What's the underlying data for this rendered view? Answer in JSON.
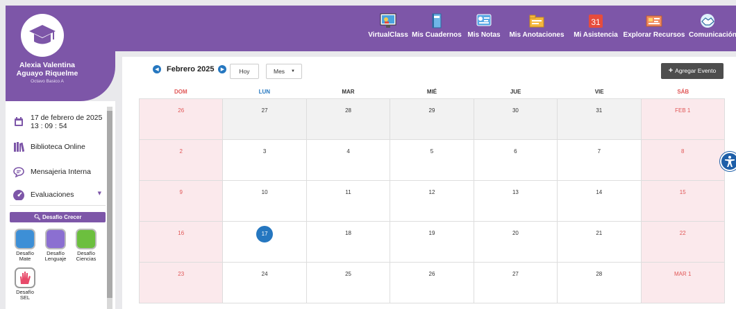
{
  "nav": [
    {
      "label": "VirtualClass",
      "icon": "virtualclass-icon"
    },
    {
      "label": "Mis Cuadernos",
      "icon": "notebook-icon"
    },
    {
      "label": "Mis Notas",
      "icon": "grades-icon"
    },
    {
      "label": "Mis Anotaciones",
      "icon": "folder-icon"
    },
    {
      "label": "Mi Asistencia",
      "icon": "calendar-31-icon"
    },
    {
      "label": "Explorar Recursos",
      "icon": "resources-icon"
    },
    {
      "label": "Comunicación",
      "icon": "handshake-icon"
    }
  ],
  "profile": {
    "name_line1": "Alexia Valentina",
    "name_line2": "Aguayo Riquelme",
    "grade": "Octavo Basico A",
    "avatar_icon": "graduation-cap-icon"
  },
  "sidebar": {
    "datetime_date": "17 de febrero de 2025",
    "datetime_time": "13 : 09 : 54",
    "items": [
      {
        "label": "Biblioteca Online",
        "icon": "library-icon"
      },
      {
        "label": "Mensajeria Interna",
        "icon": "chat-bubble-icon"
      },
      {
        "label": "Evaluaciones",
        "icon": "gauge-icon"
      }
    ],
    "desafio_button": "Desafío Crecer",
    "games": [
      {
        "line1": "Desafío",
        "line2": "Mate",
        "color": "#3d8fd6"
      },
      {
        "line1": "Desafío",
        "line2": "Lenguaje",
        "color": "#8b6fd1"
      },
      {
        "line1": "Desafío",
        "line2": "Ciencias",
        "color": "#6cbf3e"
      },
      {
        "line1": "Desafío",
        "line2": "SEL",
        "color": "#e84a6a"
      }
    ]
  },
  "calendar": {
    "month_label": "Febrero 2025",
    "today_button": "Hoy",
    "view_select": "Mes",
    "add_event_button": "Agregar Evento",
    "weekdays": [
      "DOM",
      "LUN",
      "MAR",
      "MIÉ",
      "JUE",
      "VIE",
      "SÁB"
    ],
    "weeks": [
      [
        "26",
        "27",
        "28",
        "29",
        "30",
        "31",
        "FEB 1"
      ],
      [
        "2",
        "3",
        "4",
        "5",
        "6",
        "7",
        "8"
      ],
      [
        "9",
        "10",
        "11",
        "12",
        "13",
        "14",
        "15"
      ],
      [
        "16",
        "17",
        "18",
        "19",
        "20",
        "21",
        "22"
      ],
      [
        "23",
        "24",
        "25",
        "26",
        "27",
        "28",
        "MAR 1"
      ]
    ],
    "today": "17"
  },
  "colors": {
    "brand_purple": "#7d56a8",
    "accent_blue": "#2577c0",
    "weekend_red": "#e05656",
    "weekend_bg": "#fbe9ec"
  }
}
